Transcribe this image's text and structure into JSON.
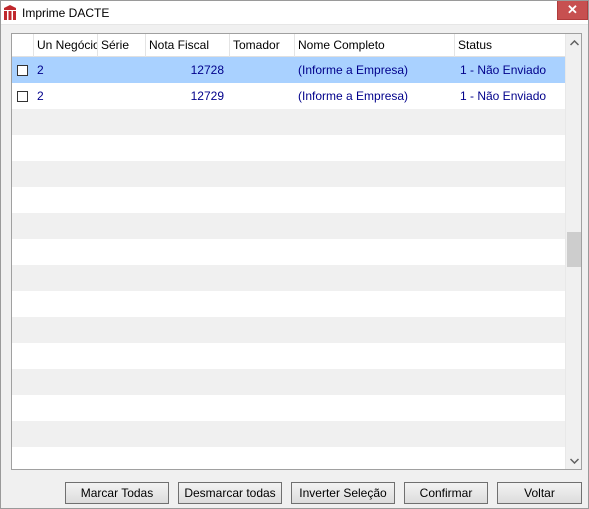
{
  "window": {
    "title": "Imprime DACTE",
    "close_label": "✕"
  },
  "grid": {
    "columns": [
      "Un Negócio",
      "Série",
      "Nota Fiscal",
      "Tomador",
      "Nome Completo",
      "Status"
    ],
    "rows": [
      {
        "un_negocio": "2",
        "serie": "",
        "nota_fiscal": "12728",
        "tomador": "",
        "nome_completo": "(Informe a Empresa)",
        "status": "1 - Não Enviado",
        "checked": false,
        "selected": true
      },
      {
        "un_negocio": "2",
        "serie": "",
        "nota_fiscal": "12729",
        "tomador": "",
        "nome_completo": "(Informe a Empresa)",
        "status": "1 - Não Enviado",
        "checked": false,
        "selected": false
      }
    ]
  },
  "scrollbar": {
    "up_icon": "chevron-up-icon",
    "down_icon": "chevron-down-icon"
  },
  "buttons": {
    "marcar_todas": "Marcar Todas",
    "desmarcar_todas": "Desmarcar todas",
    "inverter_selecao": "Inverter Seleção",
    "confirmar": "Confirmar",
    "voltar": "Voltar"
  },
  "colors": {
    "selected_row": "#a9d1ff",
    "cell_text": "#00008b",
    "close_button": "#c75050"
  }
}
